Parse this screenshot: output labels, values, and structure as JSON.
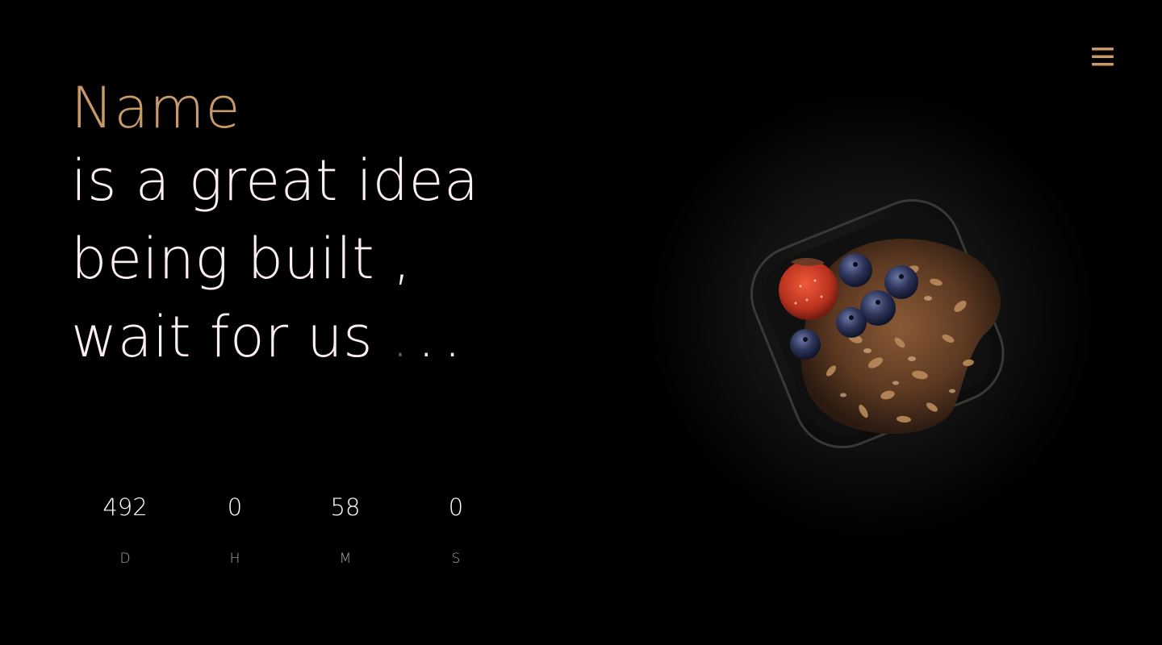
{
  "header": {
    "menu_icon": "hamburger-menu-icon",
    "accent_color": "#c99a68"
  },
  "hero_text": {
    "name": "Name",
    "line_1": "is a great idea",
    "line_2": "being built ,",
    "line_3": "wait for us",
    "dot_1": ".",
    "dot_2": ".",
    "dot_3": "."
  },
  "countdown": {
    "days": {
      "value": "492",
      "label": "D"
    },
    "hours": {
      "value": "0",
      "label": "H"
    },
    "minutes": {
      "value": "58",
      "label": "M"
    },
    "seconds": {
      "value": "0",
      "label": "S"
    }
  },
  "image": {
    "subject": "granola-bowl-with-berries-photo"
  },
  "colors": {
    "background": "#000000",
    "text": "#fbeff2",
    "accent": "#c99a68",
    "muted": "#a7a7a7"
  }
}
